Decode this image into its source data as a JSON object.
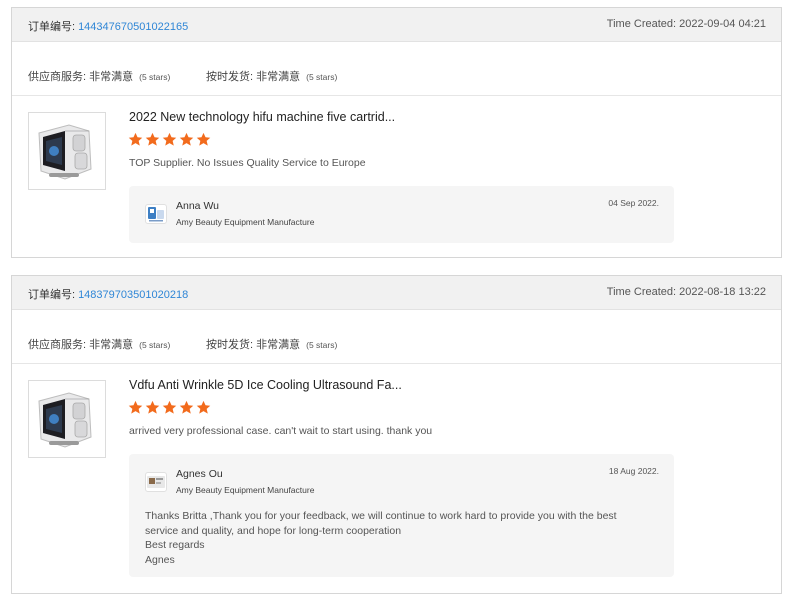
{
  "reviews": [
    {
      "order_label": "订单编号:",
      "order_number": "144347670501022165",
      "time_created": "Time Created: 2022-09-04 04:21",
      "supplier_service_label": "供应商服务: 非常满意",
      "supplier_service_stars": "(5 stars)",
      "on_time_label": "按时发货: 非常满意",
      "on_time_stars": "(5 stars)",
      "product_title": "2022 New technology hifu machine five cartrid...",
      "rating": 5,
      "review_text": "TOP Supplier. No Issues  Quality Service to Europe",
      "reply": {
        "name": "Anna Wu",
        "company": "Amy Beauty Equipment Manufacture",
        "date": "04 Sep 2022.",
        "message": []
      }
    },
    {
      "order_label": "订单编号:",
      "order_number": "148379703501020218",
      "time_created": "Time Created: 2022-08-18 13:22",
      "supplier_service_label": "供应商服务: 非常满意",
      "supplier_service_stars": "(5 stars)",
      "on_time_label": "按时发货: 非常满意",
      "on_time_stars": "(5 stars)",
      "product_title": "Vdfu Anti Wrinkle 5D Ice Cooling Ultrasound Fa...",
      "rating": 5,
      "review_text": "arrived very professional case. can't wait to start using. thank you",
      "reply": {
        "name": "Agnes Ou",
        "company": "Amy Beauty Equipment Manufacture",
        "date": "18 Aug 2022.",
        "message": [
          "Thanks Britta ,Thank you for your feedback, we will continue to work hard to provide you with the best",
          "service and quality, and hope for long-term cooperation",
          "Best regards",
          "Agnes"
        ]
      }
    }
  ],
  "colors": {
    "star": "#f26b1d",
    "link": "#2f86d6",
    "header_bg": "#f1f1f1",
    "reply_bg": "#f5f5f5"
  },
  "icons": {
    "star": "star-icon",
    "product_image": "beauty-machine-image",
    "supplier_logo": "supplier-logo-icon"
  }
}
